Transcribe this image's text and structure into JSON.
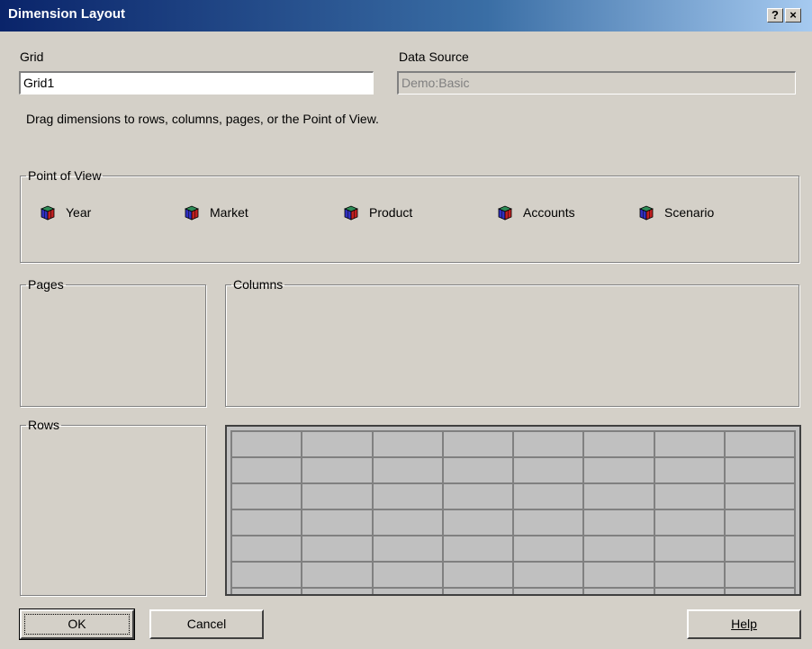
{
  "window": {
    "title": "Dimension Layout",
    "help_glyph": "?",
    "close_glyph": "×"
  },
  "grid": {
    "label": "Grid",
    "value": "Grid1"
  },
  "data_source": {
    "label": "Data Source",
    "value": "Demo:Basic"
  },
  "instruction": "Drag dimensions to rows, columns, pages, or the Point of View.",
  "point_of_view": {
    "label": "Point of View",
    "dimensions": [
      {
        "label": "Year",
        "icon": "cube-icon"
      },
      {
        "label": "Market",
        "icon": "cube-icon"
      },
      {
        "label": "Product",
        "icon": "cube-icon"
      },
      {
        "label": "Accounts",
        "icon": "cube-icon"
      },
      {
        "label": "Scenario",
        "icon": "cube-icon"
      }
    ]
  },
  "pages": {
    "label": "Pages"
  },
  "columns": {
    "label": "Columns"
  },
  "rows": {
    "label": "Rows"
  },
  "buttons": {
    "ok": "OK",
    "cancel": "Cancel",
    "help": "Help"
  },
  "colors": {
    "title_start": "#0a246a",
    "title_end": "#a6caf0",
    "face": "#d4d0c8",
    "grid_fill": "#c0c0c0"
  }
}
